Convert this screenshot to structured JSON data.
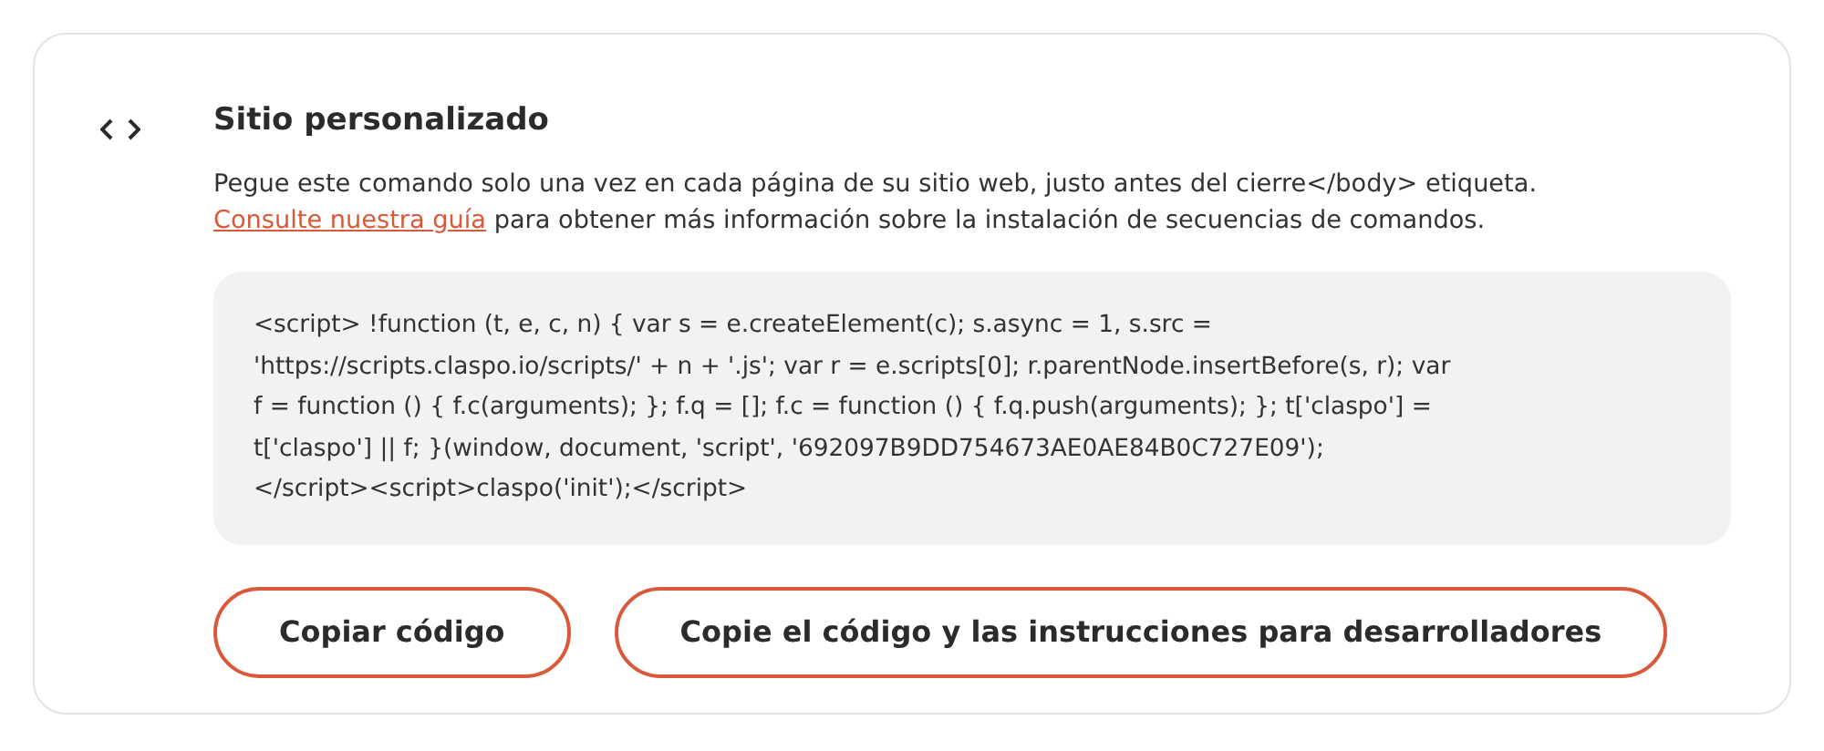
{
  "section": {
    "title": "Sitio personalizado",
    "description": "Pegue este comando solo una vez en cada página de su sitio web, justo antes del cierre</body> etiqueta.",
    "guide_link": "Consulte nuestra guía",
    "guide_text": " para obtener más información sobre la instalación de secuencias de comandos.",
    "code_lines": [
      "<script> !function (t, e, c, n) { var s = e.createElement(c); s.async = 1, s.src =",
      "'https://scripts.claspo.io/scripts/' + n + '.js'; var r = e.scripts[0]; r.parentNode.insertBefore(s, r); var",
      "f = function () { f.c(arguments); }; f.q = []; f.c = function () { f.q.push(arguments); }; t['claspo'] =",
      "t['claspo'] || f; }(window, document, 'script', '692097B9DD754673AE0AE84B0C727E09');",
      "</script><script>claspo('init');</script>"
    ],
    "buttons": [
      "Copiar código",
      "Copie el código y las instrucciones para desarrolladores"
    ]
  }
}
